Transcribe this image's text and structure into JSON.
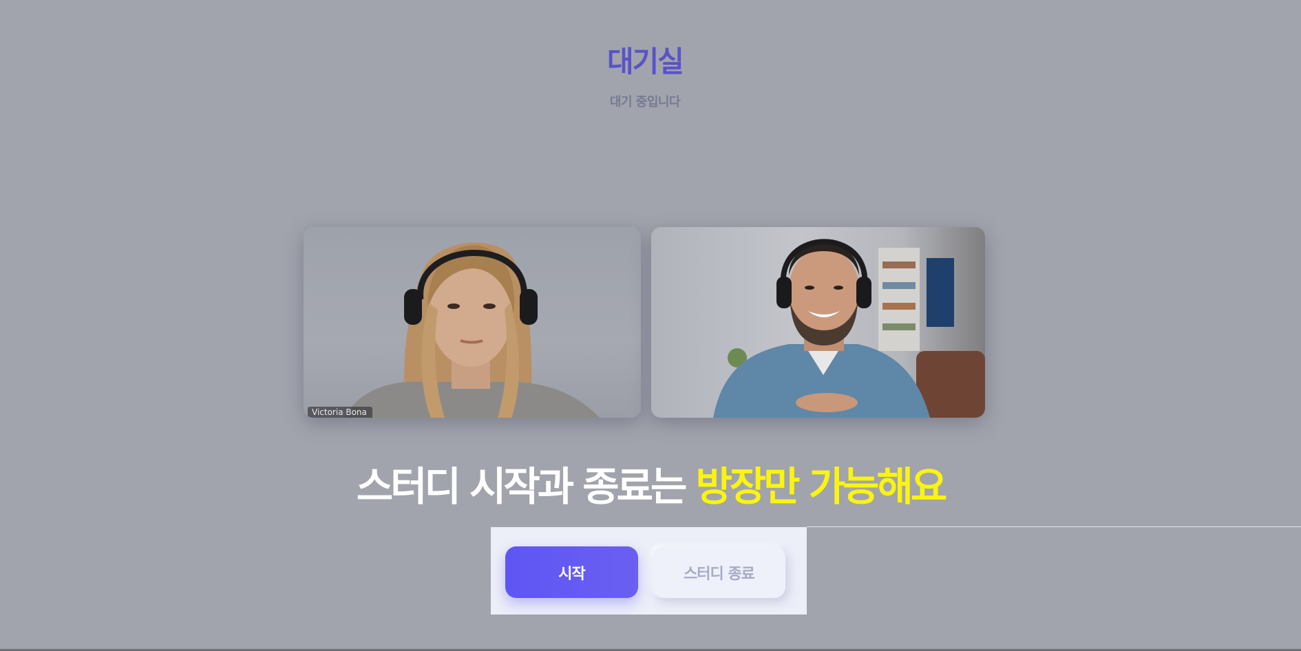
{
  "header": {
    "title": "대기실",
    "subtitle": "대기 중입니다"
  },
  "participants": [
    {
      "name": "Victoria Bona",
      "role": "participant"
    },
    {
      "name": "",
      "role": "participant"
    }
  ],
  "notice": {
    "text": "스터디 시작과 종료는 ",
    "highlight": "방장만 가능해요"
  },
  "actions": {
    "start_label": "시작",
    "end_label": "스터디 종료"
  },
  "colors": {
    "background": "#a1a4ac",
    "title": "#5a52c9",
    "accent": "#5e56f4",
    "highlight": "#fbf40f"
  }
}
